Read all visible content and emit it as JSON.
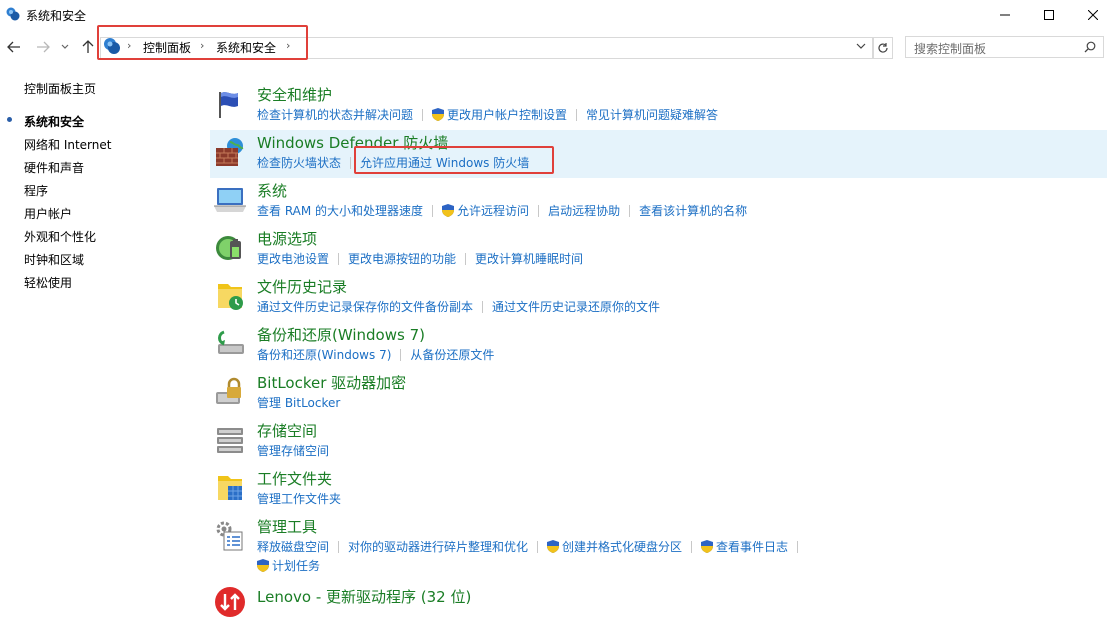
{
  "window": {
    "title": "系统和安全"
  },
  "breadcrumb": {
    "items": [
      "控制面板",
      "系统和安全"
    ]
  },
  "search": {
    "placeholder": "搜索控制面板"
  },
  "sidebar": {
    "items": [
      {
        "label": "控制面板主页",
        "current": false
      },
      {
        "label": "系统和安全",
        "current": true
      },
      {
        "label": "网络和 Internet",
        "current": false
      },
      {
        "label": "硬件和声音",
        "current": false
      },
      {
        "label": "程序",
        "current": false
      },
      {
        "label": "用户帐户",
        "current": false
      },
      {
        "label": "外观和个性化",
        "current": false
      },
      {
        "label": "时钟和区域",
        "current": false
      },
      {
        "label": "轻松使用",
        "current": false
      }
    ]
  },
  "categories": [
    {
      "title": "安全和维护",
      "icon": "flag-icon",
      "links": [
        "检查计算机的状态并解决问题",
        "更改用户帐户控制设置",
        "常见计算机问题疑难解答"
      ]
    },
    {
      "title": "Windows Defender 防火墙",
      "icon": "firewall-icon",
      "links": [
        "检查防火墙状态",
        "允许应用通过 Windows 防火墙"
      ]
    },
    {
      "title": "系统",
      "icon": "computer-icon",
      "links": [
        "查看 RAM 的大小和处理器速度",
        "允许远程访问",
        "启动远程协助",
        "查看该计算机的名称"
      ]
    },
    {
      "title": "电源选项",
      "icon": "battery-icon",
      "links": [
        "更改电池设置",
        "更改电源按钮的功能",
        "更改计算机睡眠时间"
      ]
    },
    {
      "title": "文件历史记录",
      "icon": "file-history-icon",
      "links": [
        "通过文件历史记录保存你的文件备份副本",
        "通过文件历史记录还原你的文件"
      ]
    },
    {
      "title": "备份和还原(Windows 7)",
      "icon": "backup-icon",
      "links": [
        "备份和还原(Windows 7)",
        "从备份还原文件"
      ]
    },
    {
      "title": "BitLocker 驱动器加密",
      "icon": "bitlocker-icon",
      "links": [
        "管理 BitLocker"
      ]
    },
    {
      "title": "存储空间",
      "icon": "storage-icon",
      "links": [
        "管理存储空间"
      ]
    },
    {
      "title": "工作文件夹",
      "icon": "work-folders-icon",
      "links": [
        "管理工作文件夹"
      ]
    },
    {
      "title": "管理工具",
      "icon": "admin-tools-icon",
      "links": [
        "释放磁盘空间",
        "对你的驱动器进行碎片整理和优化",
        "创建并格式化硬盘分区",
        "查看事件日志",
        "计划任务"
      ]
    },
    {
      "title": "Lenovo - 更新驱动程序 (32 位)",
      "icon": "lenovo-update-icon",
      "links": []
    }
  ],
  "colors": {
    "title_green": "#1a7d25",
    "link_blue": "#1c6fc4",
    "highlight_red": "#e0403a",
    "hover_bg": "#e5f3fb"
  }
}
